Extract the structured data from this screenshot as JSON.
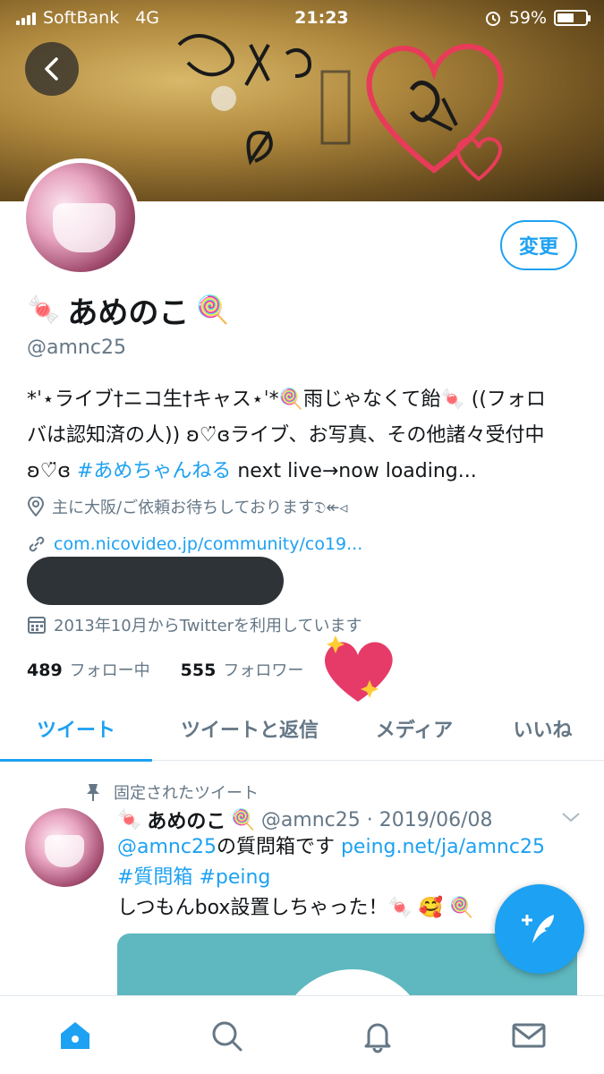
{
  "status_bar": {
    "carrier": "SoftBank",
    "network": "4G",
    "time": "21:23",
    "battery": "59%"
  },
  "profile": {
    "name": "あめのこ",
    "name_emoji_left": "🍬",
    "name_emoji_right": "🍭",
    "handle": "@amnc25",
    "edit_label": "変更",
    "bio_line1": "*ˈ⋆ライブ†ニコ生†キャス⋆ˈ*🍭雨じゃなくて飴🍬 ((フォロ",
    "bio_line2": "バは認知済の人)) ʚ♡̈ɞライブ、お写真、その他諸々受付中",
    "bio_line3_pre": "ʚ♡̈ɞ ",
    "bio_line3_hash": "#あめちゃんねる",
    "bio_line3_post": " next live→now loading...",
    "location": "主に大阪/ご依頼お待ちしております𝔇↞◃",
    "url": "com.nicovideo.jp/community/co19...",
    "joined": "2013年10月からTwitterを利用しています",
    "following_count": "489",
    "following_label": "フォロー中",
    "followers_count": "555",
    "followers_label": "フォロワー"
  },
  "tabs": [
    {
      "label": "ツイート"
    },
    {
      "label": "ツイートと返信"
    },
    {
      "label": "メディア"
    },
    {
      "label": "いいね"
    }
  ],
  "pinned_tweet": {
    "pinned_label": "固定されたツイート",
    "emoji_left": "🍬",
    "name": "あめのこ",
    "emoji_right": "🍭",
    "handle_date": "@amnc25 · 2019/06/08",
    "mention": "@amnc25",
    "text1": "の質問箱です ",
    "link": "peing.net/ja/amnc25",
    "hashtag1": "#質問箱",
    "hashtag2": "#peing",
    "text2": "しつもんbox設置しちゃった！🍬 🥰 🍭"
  },
  "colors": {
    "accent": "#1da1f2",
    "secondary_text": "#657786",
    "primary_text": "#14171a"
  },
  "icons": [
    "back-arrow-icon",
    "location-pin-icon",
    "link-icon",
    "calendar-icon",
    "pin-icon",
    "chevron-down-icon",
    "compose-feather-icon",
    "home-icon",
    "search-icon",
    "bell-icon",
    "mail-icon"
  ]
}
